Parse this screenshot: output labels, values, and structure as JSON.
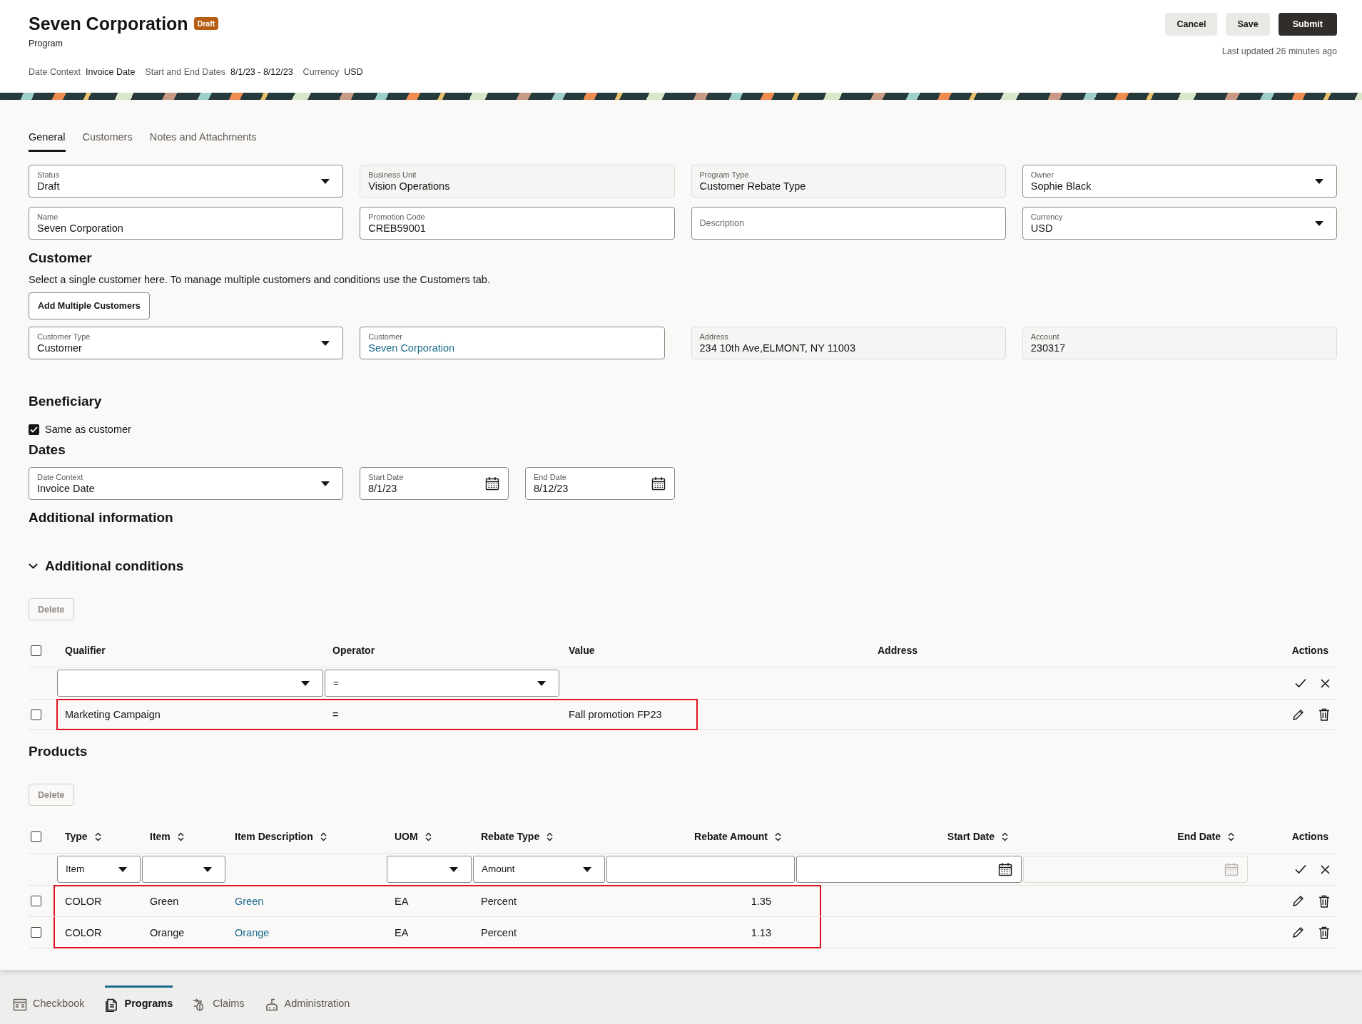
{
  "header": {
    "title": "Seven Corporation",
    "badge": "Draft",
    "subtitle": "Program",
    "context": [
      {
        "label": "Date Context",
        "value": "Invoice Date"
      },
      {
        "label": "Start and End Dates",
        "value": "8/1/23 - 8/12/23"
      },
      {
        "label": "Currency",
        "value": "USD"
      }
    ],
    "buttons": [
      {
        "label": "Cancel",
        "kind": "secondary"
      },
      {
        "label": "Save",
        "kind": "secondary"
      },
      {
        "label": "Submit",
        "kind": "primary"
      }
    ],
    "last_updated": "Last updated 26 minutes ago"
  },
  "tabs": [
    {
      "label": "General",
      "selected": true
    },
    {
      "label": "Customers",
      "selected": false
    },
    {
      "label": "Notes and Attachments",
      "selected": false
    }
  ],
  "general_fields": [
    {
      "kind": "select",
      "label": "Status",
      "value": "Draft"
    },
    {
      "kind": "readonly",
      "label": "Business Unit",
      "value": "Vision Operations"
    },
    {
      "kind": "readonly",
      "label": "Program Type",
      "value": "Customer Rebate Type"
    },
    {
      "kind": "select",
      "label": "Owner",
      "value": "Sophie Black"
    },
    {
      "kind": "text",
      "label": "Name",
      "value": "Seven Corporation"
    },
    {
      "kind": "text",
      "label": "Promotion Code",
      "value": "CREB59001"
    },
    {
      "kind": "text",
      "placeholder": "Description"
    },
    {
      "kind": "select",
      "label": "Currency",
      "value": "USD"
    }
  ],
  "customer": {
    "heading": "Customer",
    "hint": "Select a single customer here. To manage multiple customers and conditions use the Customers tab.",
    "add_button": "Add Multiple Customers",
    "fields": [
      {
        "kind": "select",
        "label": "Customer Type",
        "value": "Customer"
      },
      {
        "kind": "link",
        "label": "Customer",
        "value": "Seven Corporation"
      },
      {
        "kind": "readonly",
        "label": "Address",
        "value": "234 10th Ave,ELMONT, NY 11003"
      },
      {
        "kind": "readonly",
        "label": "Account",
        "value": "230317"
      }
    ]
  },
  "beneficiary": {
    "heading": "Beneficiary",
    "checkbox": {
      "label": "Same as customer",
      "checked": true
    }
  },
  "dates": {
    "heading": "Dates",
    "fields": [
      {
        "kind": "select",
        "label": "Date Context",
        "value": "Invoice Date"
      },
      {
        "kind": "date",
        "label": "Start Date",
        "value": "8/1/23"
      },
      {
        "kind": "date",
        "label": "End Date",
        "value": "8/12/23"
      }
    ]
  },
  "additional_information": {
    "heading": "Additional information"
  },
  "additional_conditions": {
    "heading": "Additional conditions",
    "expanded": true,
    "delete_button": {
      "label": "Delete",
      "disabled": true
    },
    "select_all_checked": false,
    "columns": [
      {
        "label": "Qualifier",
        "kind": "text",
        "filter": {
          "kind": "select"
        }
      },
      {
        "label": "Operator",
        "kind": "text",
        "filter": {
          "kind": "select",
          "value": "="
        }
      },
      {
        "label": "Value",
        "kind": "text"
      },
      {
        "label": "Address",
        "kind": "text"
      },
      {
        "label": "Actions",
        "kind": "actions"
      }
    ],
    "rows": [
      {
        "checked": false,
        "highlighted": true,
        "cells": [
          "Marketing Campaign",
          "=",
          "Fall promotion FP23"
        ]
      }
    ]
  },
  "products": {
    "heading": "Products",
    "delete_button": {
      "label": "Delete",
      "disabled": true
    },
    "select_all_checked": false,
    "columns": [
      {
        "label": "Type",
        "kind": "text",
        "sortable": true,
        "filter": {
          "kind": "select",
          "value": "Item"
        }
      },
      {
        "label": "Item",
        "kind": "text",
        "sortable": true,
        "filter": {
          "kind": "select"
        }
      },
      {
        "label": "Item Description",
        "kind": "link",
        "sortable": true
      },
      {
        "label": "UOM",
        "kind": "text",
        "sortable": true,
        "filter": {
          "kind": "select"
        }
      },
      {
        "label": "Rebate Type",
        "kind": "text",
        "sortable": true,
        "filter": {
          "kind": "select",
          "value": "Amount"
        }
      },
      {
        "label": "Rebate Amount",
        "kind": "number",
        "sortable": true,
        "filter": {
          "kind": "text"
        }
      },
      {
        "label": "Start Date",
        "kind": "number",
        "sortable": true,
        "filter": {
          "kind": "date"
        }
      },
      {
        "label": "End Date",
        "kind": "number",
        "sortable": true,
        "filter": {
          "kind": "date",
          "disabled": true
        }
      },
      {
        "label": "Actions",
        "kind": "actions",
        "sortable": false
      }
    ],
    "rows": [
      {
        "checked": false,
        "highlighted": true,
        "cells": [
          "COLOR",
          "Green",
          "Green",
          "EA",
          "Percent",
          "1.35"
        ]
      },
      {
        "checked": false,
        "highlighted": true,
        "cells": [
          "COLOR",
          "Orange",
          "Orange",
          "EA",
          "Percent",
          "1.13"
        ]
      }
    ]
  },
  "bottom_nav": [
    {
      "label": "Checkbook",
      "selected": false
    },
    {
      "label": "Programs",
      "selected": true
    },
    {
      "label": "Claims",
      "selected": false
    },
    {
      "label": "Administration",
      "selected": false
    }
  ]
}
